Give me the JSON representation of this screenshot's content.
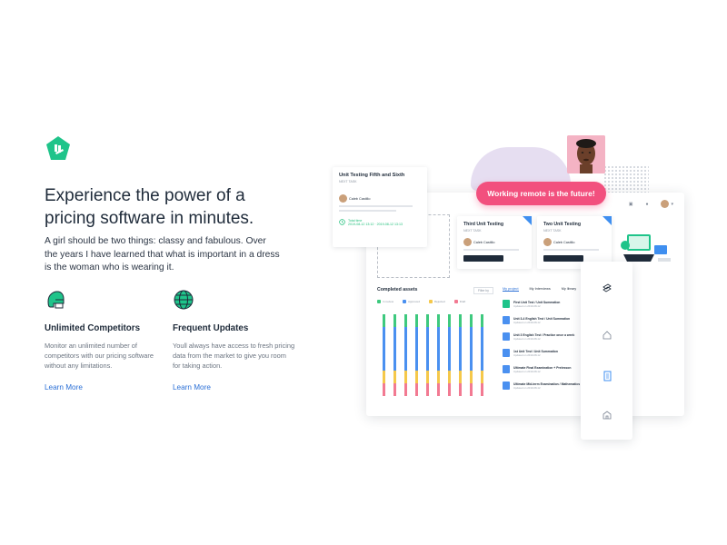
{
  "hero": {
    "headline_line1": "Experience the power of a",
    "headline_line2": "pricing software in minutes.",
    "intro": "A girl should be two things: classy and fabulous. Over the years I have learned that what is important in a dress is the woman who is wearing it."
  },
  "features": [
    {
      "icon": "helmet-icon",
      "title": "Unlimited Competitors",
      "description": "Monitor an unlimited number of competitors with our pricing software without any limitations.",
      "link": "Learn More"
    },
    {
      "icon": "globe-icon",
      "title": "Frequent Updates",
      "description": "Youll always have access to fresh pricing data from the market to give you room for taking action.",
      "link": "Learn More"
    }
  ],
  "mockup": {
    "banner": "Working remote is the future!",
    "main_card": {
      "title": "Unit Testing Fifth and Sixth",
      "subtitle": "NEXT TASK",
      "person": "Caleb Castillo",
      "status": "Total time",
      "dates": "2019-08-12 13:12  ·  2019-08-12 13:13"
    },
    "cards": [
      {
        "title": "Third Unit Testing",
        "subtitle": "NEXT TASK",
        "person": "Caleb Castillo"
      },
      {
        "title": "Two Unit Testing",
        "subtitle": "NEXT TASK",
        "person": "Caleb Castillo"
      }
    ],
    "chart": {
      "title": "Completed assets",
      "filter": "Filter by",
      "legend": [
        "In review",
        "Approved",
        "Rejected",
        "Draft"
      ]
    },
    "list_tabs": [
      "My project",
      "My Interviews",
      "My library"
    ],
    "list_rows": [
      {
        "title": "First Unit Test / Unit Summation",
        "date": "Updated on 2019-08-12"
      },
      {
        "title": "Unit 3-4 English Test / Unit Summation",
        "date": "Updated on 2019-08-12"
      },
      {
        "title": "Unit 3 English Test / Practice once a week",
        "date": "Updated on 2019-08-12"
      },
      {
        "title": "1st Unit Test / Unit Summation",
        "date": "Updated on 2019-08-12"
      },
      {
        "title": "Ultimate Final Examination + Prelesson",
        "date": "Updated on 2019-08-12"
      },
      {
        "title": "Ultimate Mid-term Examination / Mathematics",
        "date": "Updated on 2019-08-12"
      }
    ]
  },
  "colors": {
    "brand_green": "#1fc48a",
    "link_blue": "#2a6fd6",
    "pink": "#f2507e"
  }
}
